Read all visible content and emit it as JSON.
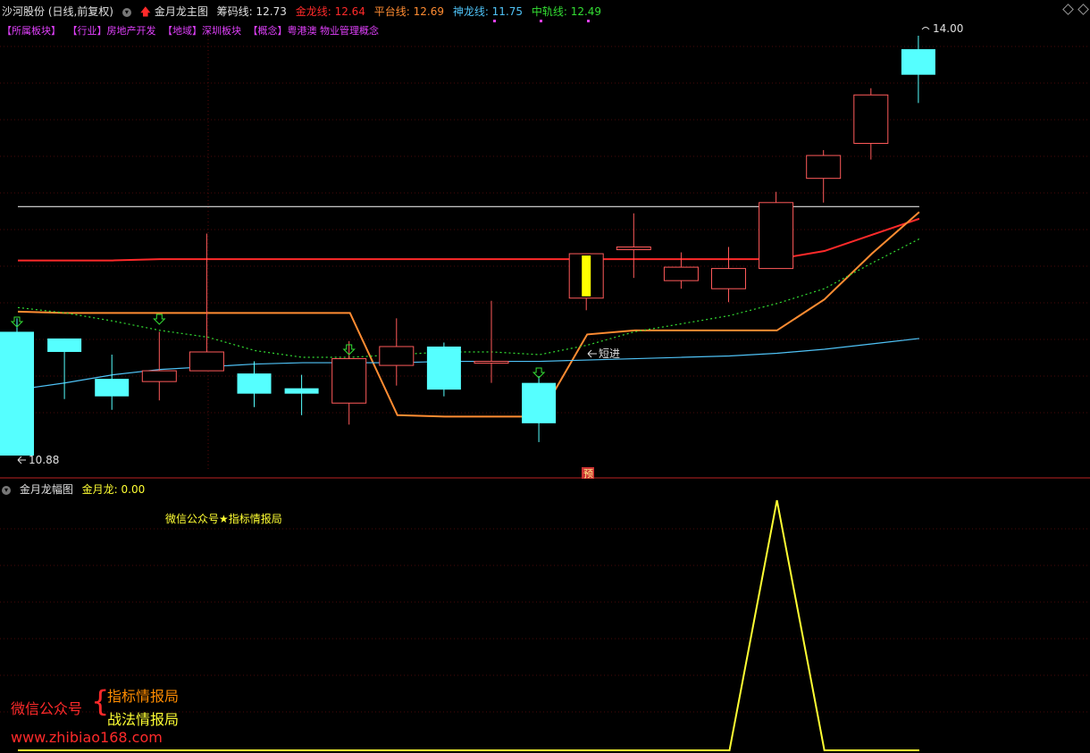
{
  "header": {
    "stock": "沙河股份 (日线,前复权)",
    "indicator": "金月龙主图",
    "values": [
      {
        "label": "筹码线: 12.73",
        "color": "#e0e0e0"
      },
      {
        "label": "金龙线: 12.64",
        "color": "#ff2a2a"
      },
      {
        "label": "平台线: 12.69",
        "color": "#ff8c32"
      },
      {
        "label": "神龙线: 11.75",
        "color": "#4fc3f7"
      },
      {
        "label": "中轨线: 12.49",
        "color": "#33dd33"
      }
    ]
  },
  "sectors": [
    "【所属板块】",
    "【行业】房地产开发",
    "【地域】深圳板块",
    "【概念】粤港澳 物业管理概念"
  ],
  "sub_header": {
    "indicator": "金月龙幅图",
    "value": "金月龙: 0.00"
  },
  "watermark": "微信公众号★指标情报局",
  "brand": {
    "pub": "微信公众号",
    "line1": "指标情报局",
    "line2": "战法情报局",
    "url": "www.zhibiao168.com"
  },
  "chart_data": [
    {
      "type": "candlestick",
      "title": "金月龙主图",
      "ylim": [
        10.88,
        14.0
      ],
      "high_label": "14.00",
      "low_label": "10.88",
      "annotations": [
        "短进",
        "预"
      ],
      "candles": [
        {
          "open": 11.8,
          "high": 11.9,
          "low": 10.88,
          "close": 10.88
        },
        {
          "open": 11.75,
          "high": 11.75,
          "low": 11.3,
          "close": 11.65
        },
        {
          "open": 11.45,
          "high": 11.63,
          "low": 11.22,
          "close": 11.32
        },
        {
          "open": 11.43,
          "high": 11.8,
          "low": 11.29,
          "close": 11.51
        },
        {
          "open": 11.51,
          "high": 12.53,
          "low": 11.51,
          "close": 11.65
        },
        {
          "open": 11.49,
          "high": 11.58,
          "low": 11.24,
          "close": 11.34
        },
        {
          "open": 11.38,
          "high": 11.48,
          "low": 11.18,
          "close": 11.34
        },
        {
          "open": 11.27,
          "high": 11.73,
          "low": 11.11,
          "close": 11.6
        },
        {
          "open": 11.55,
          "high": 11.9,
          "low": 11.4,
          "close": 11.69
        },
        {
          "open": 11.69,
          "high": 11.72,
          "low": 11.32,
          "close": 11.37
        },
        {
          "open": 11.58,
          "high": 12.03,
          "low": 11.42,
          "close": 11.58
        },
        {
          "open": 11.42,
          "high": 11.47,
          "low": 10.98,
          "close": 11.12
        },
        {
          "open": 12.05,
          "high": 12.38,
          "low": 11.96,
          "close": 12.38
        },
        {
          "open": 12.41,
          "high": 12.68,
          "low": 12.2,
          "close": 12.43
        },
        {
          "open": 12.18,
          "high": 12.39,
          "low": 12.12,
          "close": 12.28
        },
        {
          "open": 12.12,
          "high": 12.43,
          "low": 12.02,
          "close": 12.27
        },
        {
          "open": 12.27,
          "high": 12.84,
          "low": 12.27,
          "close": 12.76
        },
        {
          "open": 12.94,
          "high": 13.15,
          "low": 12.76,
          "close": 13.11
        },
        {
          "open": 13.2,
          "high": 13.61,
          "low": 13.08,
          "close": 13.56
        },
        {
          "open": 13.9,
          "high": 14.0,
          "low": 13.5,
          "close": 13.71
        }
      ],
      "series": [
        {
          "name": "筹码线",
          "color": "#e0e0e0",
          "values": [
            12.73,
            12.73,
            12.73,
            12.73,
            12.73,
            12.73,
            12.73,
            12.73,
            12.73,
            12.73,
            12.73,
            12.73,
            12.73,
            12.73,
            12.73,
            12.73,
            12.73,
            12.73,
            12.73,
            12.73
          ]
        },
        {
          "name": "金龙线",
          "color": "#ff2a2a",
          "values": [
            12.33,
            12.33,
            12.33,
            12.34,
            12.34,
            12.34,
            12.34,
            12.34,
            12.34,
            12.34,
            12.34,
            12.34,
            12.34,
            12.34,
            12.34,
            12.34,
            12.34,
            12.4,
            12.52,
            12.64
          ]
        },
        {
          "name": "平台线",
          "color": "#ff8c32",
          "values": [
            11.95,
            11.94,
            11.94,
            11.94,
            11.94,
            11.94,
            11.94,
            11.94,
            11.18,
            11.17,
            11.17,
            11.17,
            11.78,
            11.81,
            11.81,
            11.81,
            11.81,
            12.04,
            12.38,
            12.69
          ]
        },
        {
          "name": "神龙线",
          "color": "#4fc3f7",
          "values": [
            11.37,
            11.42,
            11.48,
            11.52,
            11.54,
            11.56,
            11.57,
            11.57,
            11.57,
            11.58,
            11.58,
            11.58,
            11.59,
            11.6,
            11.61,
            11.62,
            11.64,
            11.67,
            11.71,
            11.75
          ]
        },
        {
          "name": "中轨线",
          "color": "#33dd33",
          "values": [
            11.98,
            11.94,
            11.88,
            11.81,
            11.76,
            11.66,
            11.61,
            11.61,
            11.63,
            11.65,
            11.65,
            11.63,
            11.7,
            11.8,
            11.86,
            11.92,
            12.01,
            12.12,
            12.31,
            12.49
          ]
        }
      ]
    },
    {
      "type": "line",
      "title": "金月龙幅图",
      "ylim": [
        0,
        1
      ],
      "series": [
        {
          "name": "金月龙",
          "color": "#ffff33",
          "values": [
            0,
            0,
            0,
            0,
            0,
            0,
            0,
            0,
            0,
            0,
            0,
            0,
            0,
            0,
            0,
            0,
            1,
            0,
            0,
            0
          ]
        }
      ]
    }
  ]
}
